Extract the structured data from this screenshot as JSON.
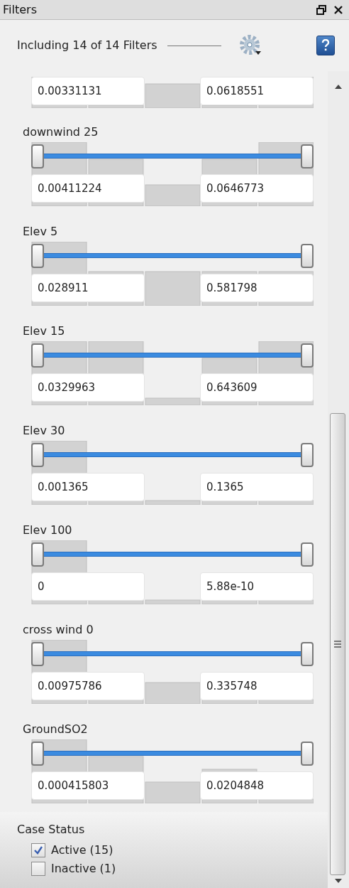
{
  "window": {
    "title": "Filters"
  },
  "header": {
    "summary": "Including 14 of 14 Filters"
  },
  "partial_filter": {
    "min": "0.00331131",
    "max": "0.0618551"
  },
  "filters": [
    {
      "name": "downwind 25",
      "min": "0.00411224",
      "max": "0.0646773",
      "lower_handle": {
        "level": 0
      },
      "upper_handle": {
        "level": 1
      }
    },
    {
      "name": "Elev 5",
      "min": "0.028911",
      "max": "0.581798",
      "lower_handle": {
        "level": 0
      },
      "upper_handle": {
        "level": 1
      }
    },
    {
      "name": "Elev 15",
      "min": "0.0329963",
      "max": "0.643609",
      "lower_handle": {
        "level": 0
      },
      "upper_handle": {
        "level": 1
      }
    },
    {
      "name": "Elev 30",
      "min": "0.001365",
      "max": "0.1365",
      "lower_handle": {
        "level": 0
      },
      "upper_handle": {
        "level": 1
      }
    },
    {
      "name": "Elev 100",
      "min": "0",
      "max": "5.88e-10",
      "lower_handle": {
        "level": 0
      },
      "upper_handle": {
        "level": 1
      }
    },
    {
      "name": "cross wind 0",
      "min": "0.00975786",
      "max": "0.335748",
      "lower_handle": {
        "level": 0
      },
      "upper_handle": {
        "level": 1
      }
    },
    {
      "name": "GroundSO2",
      "min": "0.000415803",
      "max": "0.0204848",
      "lower_handle": {
        "level": 0
      },
      "upper_handle": {
        "level": 1
      }
    }
  ],
  "case_status": {
    "title": "Case Status",
    "options": [
      {
        "label": "Active (15)",
        "checked": true
      },
      {
        "label": "Inactive (1)",
        "checked": false
      }
    ]
  }
}
